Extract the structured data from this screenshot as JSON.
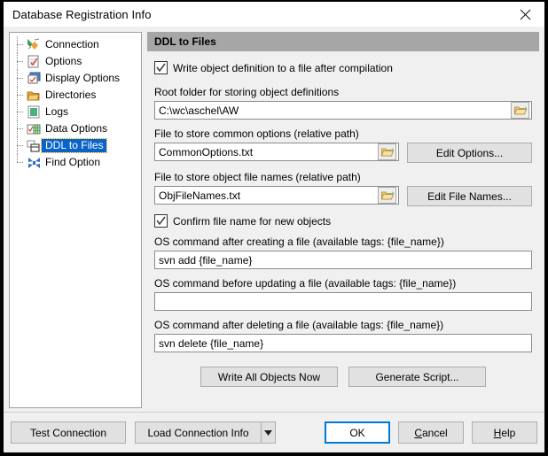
{
  "window": {
    "title": "Database Registration Info",
    "close_icon": "close-icon"
  },
  "sidebar": {
    "items": [
      {
        "label": "Connection",
        "icon": "connection-icon",
        "selected": false
      },
      {
        "label": "Options",
        "icon": "options-icon",
        "selected": false
      },
      {
        "label": "Display Options",
        "icon": "display-options-icon",
        "selected": false
      },
      {
        "label": "Directories",
        "icon": "folder-icon",
        "selected": false
      },
      {
        "label": "Logs",
        "icon": "logs-icon",
        "selected": false
      },
      {
        "label": "Data Options",
        "icon": "data-options-icon",
        "selected": false
      },
      {
        "label": "DDL to Files",
        "icon": "ddl-to-files-icon",
        "selected": true
      },
      {
        "label": "Find Option",
        "icon": "find-option-icon",
        "selected": false
      }
    ]
  },
  "panel": {
    "header": "DDL to Files",
    "write_definition_checkbox": {
      "label": "Write object definition to a file after compilation",
      "checked": true
    },
    "root_folder": {
      "label": "Root folder for storing object definitions",
      "value": "C:\\wc\\aschel\\AW",
      "browse_icon": "open-folder-icon"
    },
    "common_options_file": {
      "label": "File to store common options (relative path)",
      "value": "CommonOptions.txt",
      "browse_icon": "open-folder-icon",
      "button": "Edit Options..."
    },
    "object_file_names": {
      "label": "File to store object file names (relative path)",
      "value": "ObjFileNames.txt",
      "browse_icon": "open-folder-icon",
      "button": "Edit File Names..."
    },
    "confirm_checkbox": {
      "label": "Confirm file name for new objects",
      "checked": true
    },
    "cmd_after_create": {
      "label": "OS command after creating a file (available tags: {file_name})",
      "value": "svn add {file_name}"
    },
    "cmd_before_update": {
      "label": "OS command before updating a file (available tags: {file_name})",
      "value": ""
    },
    "cmd_after_delete": {
      "label": "OS command after deleting a file (available tags: {file_name})",
      "value": "svn delete {file_name}"
    },
    "write_all_button": "Write All Objects Now",
    "generate_script_button": "Generate Script..."
  },
  "footer": {
    "test_connection": "Test Connection",
    "load_connection_info": "Load Connection Info",
    "load_dropdown_icon": "chevron-down-icon",
    "ok": "OK",
    "cancel_pre": "C",
    "cancel_post": "ancel",
    "help_pre": "H",
    "help_post": "elp"
  },
  "colors": {
    "selection_blue": "#0a64c8",
    "focus_blue": "#0078d7",
    "panel_header_gray": "#a6a6a6",
    "dialog_gray": "#f0f0f0"
  }
}
